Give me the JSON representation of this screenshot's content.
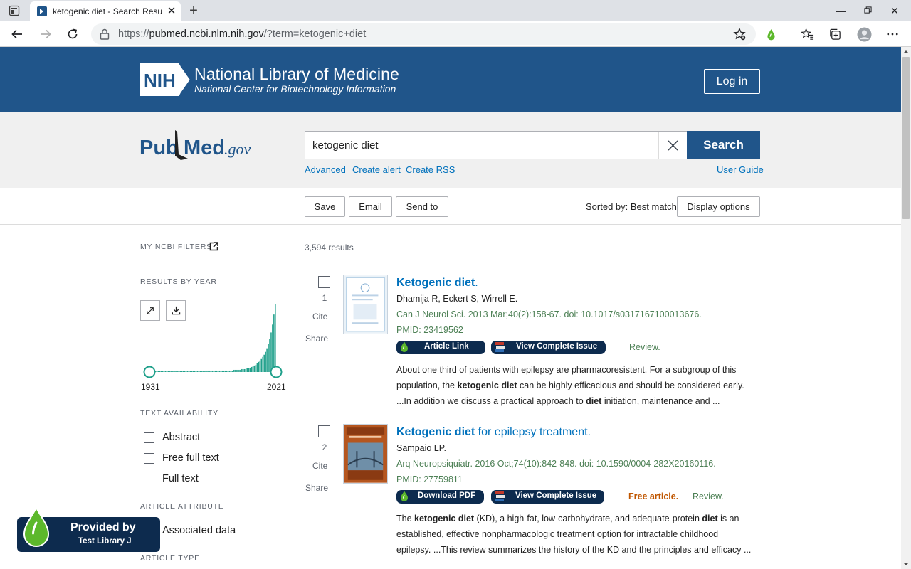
{
  "browser": {
    "tab_title": "ketogenic diet - Search Results - PubMed",
    "url_prefix": "https://",
    "url_host": "pubmed.ncbi.nlm.nih.gov",
    "url_path": "/?term=ketogenic+diet"
  },
  "banner": {
    "logo_text": "NIH",
    "title": "National Library of Medicine",
    "subtitle": "National Center for Biotechnology Information",
    "login": "Log in"
  },
  "search": {
    "logo_pub": "Pub",
    "logo_med": "Med",
    "logo_gov": ".gov",
    "query": "ketogenic diet",
    "button": "Search",
    "links": {
      "advanced": "Advanced",
      "alert": "Create alert",
      "rss": "Create RSS",
      "guide": "User Guide"
    }
  },
  "actions": {
    "save": "Save",
    "email": "Email",
    "send_to": "Send to",
    "sorted_by": "Sorted by: Best match",
    "display_options": "Display options"
  },
  "sidebar": {
    "my_filters": "MY NCBI FILTERS",
    "results_by_year": "RESULTS BY YEAR",
    "year_start": "1931",
    "year_end": "2021",
    "text_availability": "TEXT AVAILABILITY",
    "text_filters": [
      "Abstract",
      "Free full text",
      "Full text"
    ],
    "article_attribute": "ARTICLE ATTRIBUTE",
    "attribute_filters": [
      "Associated data"
    ],
    "article_type": "ARTICLE TYPE"
  },
  "results": {
    "count": "3,594 results",
    "items": [
      {
        "number": "1",
        "cite": "Cite",
        "share": "Share",
        "title_bold": "Ketogenic diet",
        "title_rest": ".",
        "authors": "Dhamija R, Eckert S, Wirrell E.",
        "journal": "Can J Neurol Sci. 2013 Mar;40(2):158-67. doi: 10.1017/s0317167100013676.",
        "pmid": "PMID: 23419562",
        "btn1": "Article Link",
        "btn2": "View Complete Issue",
        "free": "",
        "review": "Review.",
        "snippet": {
          "l1": "About one third of patients with epilepsy are pharmacoresistent. For a subgroup of this",
          "l2a": "population, the ",
          "l2b": "ketogenic diet",
          "l2c": " can be highly efficacious and should be considered early.",
          "l3a": "...In addition we discuss a practical approach to ",
          "l3b": "diet",
          "l3c": " initiation, maintenance and ..."
        }
      },
      {
        "number": "2",
        "cite": "Cite",
        "share": "Share",
        "title_bold": "Ketogenic diet",
        "title_rest": " for epilepsy treatment.",
        "authors": "Sampaio LP.",
        "journal": "Arq Neuropsiquiatr. 2016 Oct;74(10):842-848. doi: 10.1590/0004-282X20160116.",
        "pmid": "PMID: 27759811",
        "btn1": "Download PDF",
        "btn2": "View Complete Issue",
        "free": "Free article.",
        "review": "Review.",
        "snippet": {
          "l1a": "The ",
          "l1b": "ketogenic diet",
          "l1c": " (KD), a high-fat, low-carbohydrate, and adequate-protein ",
          "l1d": "diet",
          "l1e": " is an",
          "l2": "established, effective nonpharmacologic treatment option for intractable childhood",
          "l3": "epilepsy. ...This review summarizes the history of the KD and the principles and efficacy ..."
        }
      }
    ]
  },
  "badge": {
    "line1": "Provided by",
    "line2": "Test Library J"
  },
  "chart_data": {
    "type": "bar",
    "x_range": [
      1931,
      2021
    ],
    "note_values_relative": [
      1,
      1,
      1,
      1,
      1,
      1,
      1,
      1,
      1,
      1,
      1,
      1,
      1,
      1,
      1,
      1,
      1,
      1,
      1,
      1,
      1,
      1,
      1,
      1,
      1,
      1,
      1,
      1,
      1,
      1,
      1,
      1,
      1,
      1,
      1,
      1,
      1,
      1,
      1,
      1,
      2,
      2,
      2,
      2,
      2,
      2,
      2,
      2,
      2,
      2,
      2,
      2,
      2,
      2,
      2,
      2,
      2,
      2,
      2,
      2,
      3,
      3,
      3,
      3,
      3,
      3,
      4,
      4,
      4,
      5,
      5,
      5,
      6,
      7,
      8,
      9,
      10,
      12,
      14,
      16,
      18,
      21,
      24,
      28,
      33,
      39,
      46,
      55,
      66,
      80,
      95
    ]
  },
  "colors": {
    "nih_blue": "#20558a",
    "link_blue": "#0071bc",
    "journal_green": "#4d8055",
    "free_orange": "#c05600",
    "library_navy": "#0d2b4e",
    "histogram_teal": "#20a08b"
  }
}
